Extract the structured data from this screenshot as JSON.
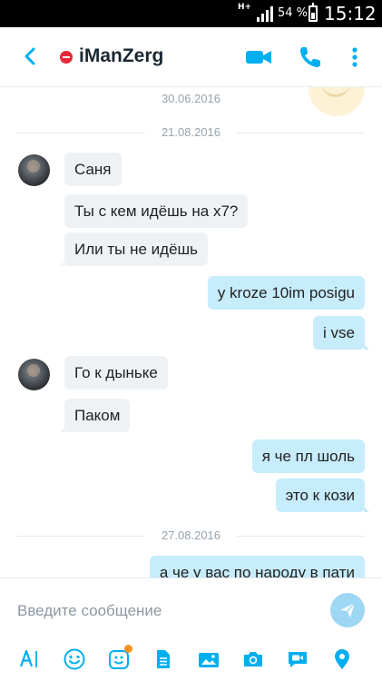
{
  "status_bar": {
    "network": "H+",
    "battery_percent": "54 %",
    "battery_level": 0.54,
    "time": "15:12"
  },
  "header": {
    "contact_name": "iManZerg",
    "presence": "do-not-disturb",
    "icons": [
      "back-icon",
      "video-call-icon",
      "voice-call-icon",
      "more-vert-icon"
    ],
    "accent_color": "#00aff0"
  },
  "chat": {
    "date_separators": [
      "30.06.2016",
      "21.08.2016",
      "27.08.2016"
    ],
    "messages": [
      {
        "direction": "in",
        "text": "Саня"
      },
      {
        "direction": "in",
        "text": "Ты с кем идёшь на х7?"
      },
      {
        "direction": "in",
        "text": "Или ты не идёшь"
      },
      {
        "direction": "out",
        "text": "у kroze 10im posigu"
      },
      {
        "direction": "out",
        "text": "i vse"
      },
      {
        "direction": "in",
        "text": "Го к дыньке"
      },
      {
        "direction": "in",
        "text": "Паком"
      },
      {
        "direction": "out",
        "text": "я че пл шоль"
      },
      {
        "direction": "out",
        "text": "это к кози"
      },
      {
        "direction": "out",
        "text": "а че у вас по народу в пати"
      }
    ]
  },
  "composer": {
    "placeholder": "Введите сообщение",
    "value": "",
    "toolbar_icons": [
      "font-style-icon",
      "emoticon-icon",
      "mojis-icon",
      "file-icon",
      "photo-gallery-icon",
      "camera-icon",
      "video-message-icon",
      "location-icon"
    ]
  }
}
